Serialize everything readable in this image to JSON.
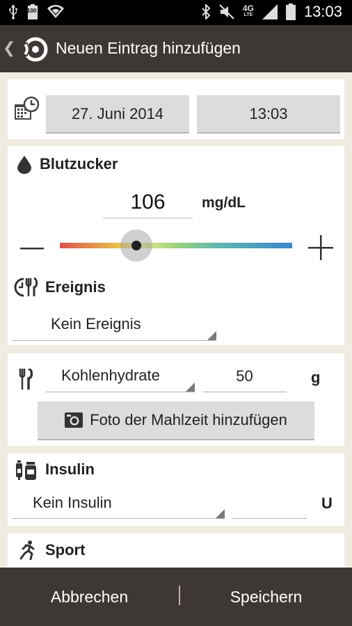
{
  "status_bar": {
    "time": "13:03",
    "battery_text": "100",
    "network_label": "4G",
    "network_sub": "LTE",
    "icons": [
      "usb-icon",
      "battery-icon",
      "wifi-icon",
      "bluetooth-icon",
      "mute-icon",
      "signal-icon",
      "battery-full-icon"
    ]
  },
  "action_bar": {
    "title": "Neuen Eintrag hinzufügen",
    "back_icon": "chevron-left-icon",
    "logo_icon": "app-logo-icon"
  },
  "datetime": {
    "date": "27. Juni 2014",
    "time": "13:03",
    "icon": "calendar-clock-icon"
  },
  "blood_sugar": {
    "title": "Blutzucker",
    "value": "106",
    "unit": "mg/dL",
    "slider_level": 0.33,
    "icon": "drop-icon"
  },
  "event": {
    "title": "Ereignis",
    "selected": "Kein Ereignis",
    "icon": "clock-cutlery-icon"
  },
  "carbs": {
    "type_selected": "Kohlenhydrate",
    "value": "50",
    "unit": "g",
    "photo_button": "Foto der Mahlzeit hinzufügen",
    "icon": "cutlery-icon"
  },
  "insulin": {
    "title": "Insulin",
    "selected": "Kein Insulin",
    "value": "",
    "unit": "U",
    "icon": "insulin-pen-icon"
  },
  "sport": {
    "title": "Sport",
    "icon": "running-icon"
  },
  "bottom_bar": {
    "cancel": "Abbrechen",
    "save": "Speichern"
  },
  "colors": {
    "action_bar": "#3d3835",
    "background": "#f1ece1",
    "slider_red": "#d9534f",
    "slider_blue": "#3a86c8"
  }
}
